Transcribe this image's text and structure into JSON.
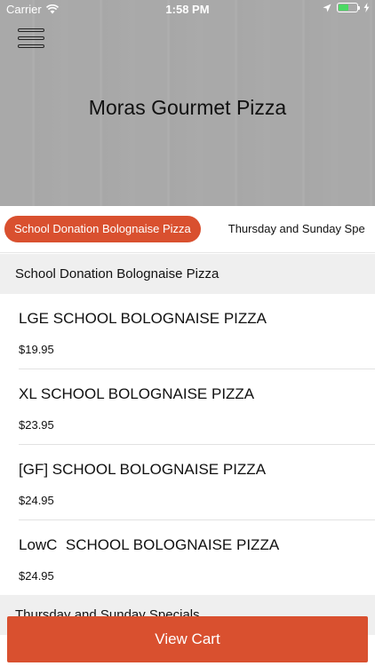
{
  "status_bar": {
    "carrier": "Carrier",
    "time": "1:58 PM"
  },
  "header": {
    "title": "Moras Gourmet Pizza",
    "menu_icon": "hamburger-menu-icon"
  },
  "tabs": [
    {
      "label": "School Donation Bolognaise Pizza",
      "active": true
    },
    {
      "label": "Thursday and Sunday Spe",
      "active": false
    }
  ],
  "sections": [
    {
      "title": "School Donation Bolognaise Pizza",
      "items": [
        {
          "name": "LGE SCHOOL BOLOGNAISE PIZZA",
          "price": "$19.95"
        },
        {
          "name": "XL SCHOOL BOLOGNAISE PIZZA",
          "price": "$23.95"
        },
        {
          "name": "[GF] SCHOOL BOLOGNAISE PIZZA",
          "price": "$24.95"
        },
        {
          "name": "LowC  SCHOOL BOLOGNAISE PIZZA",
          "price": "$24.95"
        }
      ]
    },
    {
      "title": "Thursday and Sunday Specials"
    }
  ],
  "cart": {
    "label": "View Cart"
  },
  "colors": {
    "accent": "#d9502f",
    "section_bg": "#efefef"
  }
}
